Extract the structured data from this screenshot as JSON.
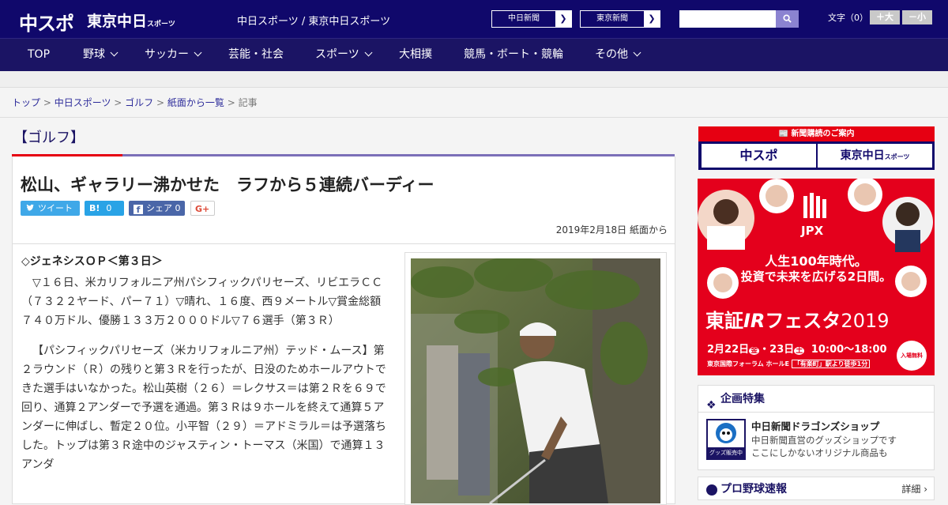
{
  "header": {
    "logo_main": "中スポ",
    "logo_sub": "東京中日",
    "logo_sub_small": "スポーツ",
    "site_title": "中日スポーツ / 東京中日スポーツ",
    "ext_links": [
      "中日新聞",
      "東京新聞"
    ],
    "search_placeholder": "",
    "font_size_label": "文字（0）",
    "font_plus": "＋大",
    "font_minus": "－小"
  },
  "nav": {
    "items": [
      {
        "label": "TOP",
        "dropdown": false
      },
      {
        "label": "野球",
        "dropdown": true
      },
      {
        "label": "サッカー",
        "dropdown": true
      },
      {
        "label": "芸能・社会",
        "dropdown": false
      },
      {
        "label": "スポーツ",
        "dropdown": true
      },
      {
        "label": "大相撲",
        "dropdown": false
      },
      {
        "label": "競馬・ボート・競輪",
        "dropdown": false
      },
      {
        "label": "その他",
        "dropdown": true
      }
    ]
  },
  "breadcrumb": {
    "items": [
      "トップ",
      "中日スポーツ",
      "ゴルフ",
      "紙面から一覧"
    ],
    "current": "記事",
    "sep": " > "
  },
  "article": {
    "category": "【ゴルフ】",
    "headline": "松山、ギャラリー沸かせた　ラフから５連続バーディー",
    "share": {
      "tweet": "ツイート",
      "hatena_icon": "B!",
      "hatena_count": "0",
      "fb_label": "シェア",
      "fb_count": "0",
      "gplus": "G+"
    },
    "date": "2019年2月18日 紙面から",
    "subhead": "◇ジェネシスＯＰ＜第３日＞",
    "paragraphs": [
      "▽１６日、米カリフォルニア州パシフィックパリセーズ、リビエラＣＣ（７３２２ヤード、パー７１）▽晴れ、１６度、西９メートル▽賞金総額７４０万ドル、優勝１３３万２０００ドル▽７６選手（第３Ｒ）",
      "【パシフィックパリセーズ（米カリフォルニア州）テッド・ムース】第２ラウンド（Ｒ）の残りと第３Ｒを行ったが、日没のためホールアウトできた選手はいなかった。松山英樹（２６）＝レクサス＝は第２Ｒを６９で回り、通算２アンダーで予選を通過。第３Ｒは９ホールを終えて通算５アンダーに伸ばし、暫定２０位。小平智（２９）＝アドミラル＝は予選落ちした。トップは第３Ｒ途中のジャスティン・トーマス（米国）で通算１３アンダ"
    ]
  },
  "sidebar": {
    "subscribe_head": "新聞購読のご案内",
    "subscribe_a": "中スポ",
    "subscribe_b": "東京中日",
    "subscribe_b_small": "スポーツ",
    "ad": {
      "brand": "JPX",
      "tagline1": "人生100年時代。",
      "tagline2": "投資で未来を広げる2日間。",
      "title_a": "東証",
      "title_b": "IR",
      "title_c": "フェスタ",
      "year": "2019",
      "dates": "2月22日",
      "dow1": "金",
      "dates2": "・23日",
      "dow2": "土",
      "time": "10:00～18:00",
      "venue": "東京国際フォーラム ホールE",
      "access": "「有楽町」駅より徒歩1分",
      "free": "入場無料"
    },
    "feature_title": "企画特集",
    "feature_item_title": "中日新聞ドラゴンズショップ",
    "feature_item_desc1": "中日新聞直営のグッズショップです",
    "feature_item_desc2": "ここにしかないオリジナル商品も",
    "feature_badge": "グッズ販売中",
    "baseball_title": "プロ野球速報",
    "baseball_more": "詳細 ›"
  },
  "colors": {
    "header_bg": "#10086b",
    "nav_bg": "#1b1464",
    "accent_red": "#e60012",
    "accent_purple": "#7b6fb8",
    "link": "#2c2b9a"
  }
}
